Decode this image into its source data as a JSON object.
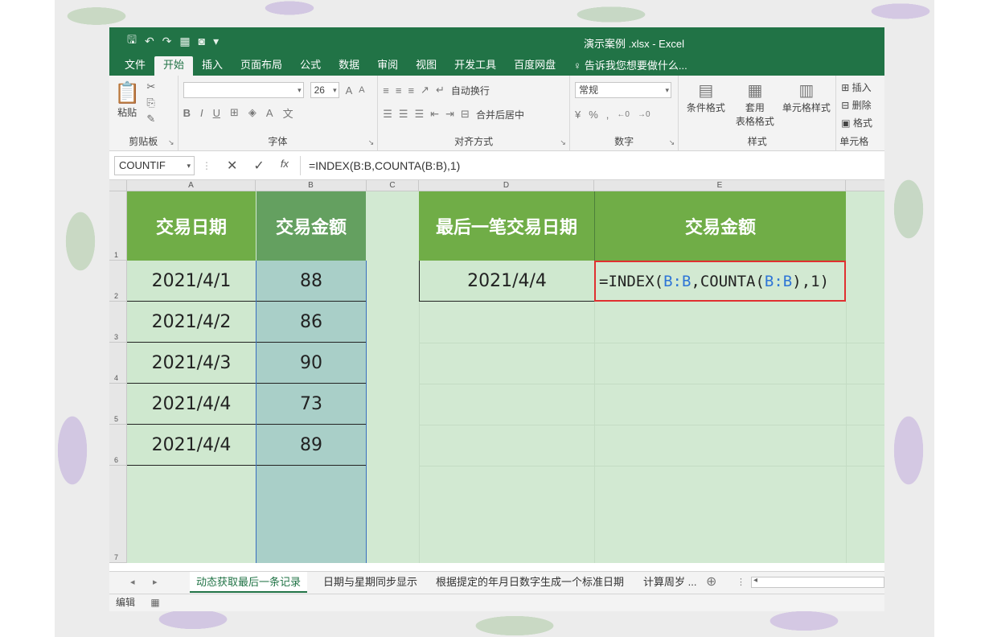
{
  "window": {
    "title": "演示案例 .xlsx - Excel"
  },
  "qat": {
    "save": "🖫",
    "undo": "↶",
    "redo": "↷",
    "more": "▾"
  },
  "tabs": [
    {
      "label": "文件"
    },
    {
      "label": "开始"
    },
    {
      "label": "插入"
    },
    {
      "label": "页面布局"
    },
    {
      "label": "公式"
    },
    {
      "label": "数据"
    },
    {
      "label": "审阅"
    },
    {
      "label": "视图"
    },
    {
      "label": "开发工具"
    },
    {
      "label": "百度网盘"
    }
  ],
  "tell_me": "告诉我您想要做什么...",
  "ribbon": {
    "clipboard": {
      "paste": "粘贴",
      "label": "剪贴板"
    },
    "font": {
      "size": "26",
      "label": "字体",
      "bold": "B",
      "italic": "I",
      "underline": "U",
      "grow": "A",
      "shrink": "A"
    },
    "alignment": {
      "wrap": "自动换行",
      "merge": "合并后居中",
      "label": "对齐方式"
    },
    "number": {
      "format": "常规",
      "label": "数字",
      "percent": "%"
    },
    "styles": {
      "conditional": "条件格式",
      "table_line1": "套用",
      "table_line2": "表格格式",
      "cell_styles": "单元格样式",
      "label": "样式"
    },
    "cells": {
      "insert": "插入",
      "delete": "删除",
      "format": "格式",
      "label": "单元格"
    }
  },
  "formula_bar": {
    "name_box": "COUNTIF",
    "formula": "=INDEX(B:B,COUNTA(B:B),1)",
    "fx": "fx"
  },
  "columns": [
    "A",
    "B",
    "C",
    "D",
    "E"
  ],
  "rows": [
    "1",
    "2",
    "3",
    "4",
    "5",
    "6",
    "7"
  ],
  "table": {
    "headers": [
      "交易日期",
      "交易金额"
    ],
    "rows": [
      {
        "date": "2021/4/1",
        "amount": "88"
      },
      {
        "date": "2021/4/2",
        "amount": "86"
      },
      {
        "date": "2021/4/3",
        "amount": "90"
      },
      {
        "date": "2021/4/4",
        "amount": "73"
      },
      {
        "date": "2021/4/4",
        "amount": "89"
      }
    ]
  },
  "lookup": {
    "header_last_date": "最后一笔交易日期",
    "header_amount": "交易金额",
    "last_date": "2021/4/4",
    "formula_parts": [
      "=INDEX(",
      "B:B",
      ",COUNTA(",
      "B:B",
      "),1)"
    ]
  },
  "sheet_tabs": [
    "动态获取最后一条记录",
    "日期与星期同步显示",
    "根据提定的年月日数字生成一个标准日期",
    "计算周岁 ..."
  ],
  "status": {
    "mode": "编辑"
  },
  "colors": {
    "excel_green": "#217346",
    "header_green": "#70ad47",
    "formula_border": "#e03030",
    "ref_blue": "#2e75d6"
  }
}
